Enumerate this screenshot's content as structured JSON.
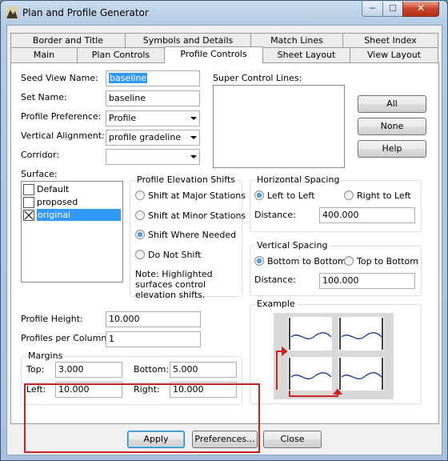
{
  "window": {
    "title": "Plan and Profile Generator",
    "min_glyph": "─",
    "max_glyph": "☐",
    "close_glyph": "✕"
  },
  "tabs": {
    "back_row": [
      "Border and Title",
      "Symbols and Details",
      "Match Lines",
      "Sheet Index"
    ],
    "front_row": [
      "Main",
      "Plan Controls",
      "Profile Controls",
      "Sheet Layout",
      "View Layout"
    ],
    "active": "Profile Controls"
  },
  "form": {
    "seed_view_name": {
      "label": "Seed View Name:",
      "value": "baseline"
    },
    "set_name": {
      "label": "Set Name:",
      "value": "baseline"
    },
    "profile_preference": {
      "label": "Profile Preference:",
      "value": "Profile"
    },
    "vertical_alignment": {
      "label": "Vertical Alignment:",
      "value": "profile gradeline"
    },
    "corridor": {
      "label": "Corridor:",
      "value": ""
    },
    "surface": {
      "label": "Surface:",
      "items": [
        "Default",
        "proposed",
        "original"
      ],
      "checked": [
        "original"
      ],
      "selected": "original"
    },
    "super_control_lines": {
      "label": "Super Control Lines:"
    }
  },
  "buttons": {
    "all": "All",
    "none": "None",
    "help": "Help"
  },
  "profile_elevation_shifts": {
    "title": "Profile Elevation Shifts",
    "options": [
      "Shift at Major Stations",
      "Shift at Minor Stations",
      "Shift Where Needed",
      "Do Not Shift"
    ],
    "selected": "Shift Where Needed",
    "note": "Note: Highlighted surfaces control elevation shifts."
  },
  "horizontal_spacing": {
    "title": "Horizontal Spacing",
    "options": [
      "Left to Left",
      "Right to Left"
    ],
    "selected": "Left to Left",
    "distance_label": "Distance:",
    "distance": "400.000"
  },
  "vertical_spacing": {
    "title": "Vertical Spacing",
    "options": [
      "Bottom to Bottom",
      "Top to Bottom"
    ],
    "selected": "Bottom to Bottom",
    "distance_label": "Distance:",
    "distance": "100.000"
  },
  "profile_height": {
    "label": "Profile Height:",
    "value": "10.000"
  },
  "profiles_per_column": {
    "label": "Profiles per Column:",
    "value": "1"
  },
  "margins": {
    "title": "Margins",
    "top_label": "Top:",
    "top": "3.000",
    "bottom_label": "Bottom:",
    "bottom": "5.000",
    "left_label": "Left:",
    "left": "10.000",
    "right_label": "Right:",
    "right": "10.000"
  },
  "example": {
    "title": "Example",
    "arrow_color": "#cc2222",
    "curve_color": "#1a3fa0"
  },
  "footer": {
    "apply": "Apply",
    "preferences": "Preferences...",
    "close": "Close"
  },
  "colors": {
    "highlight": "#3399ff",
    "annotation_border": "#cc1f1f"
  }
}
